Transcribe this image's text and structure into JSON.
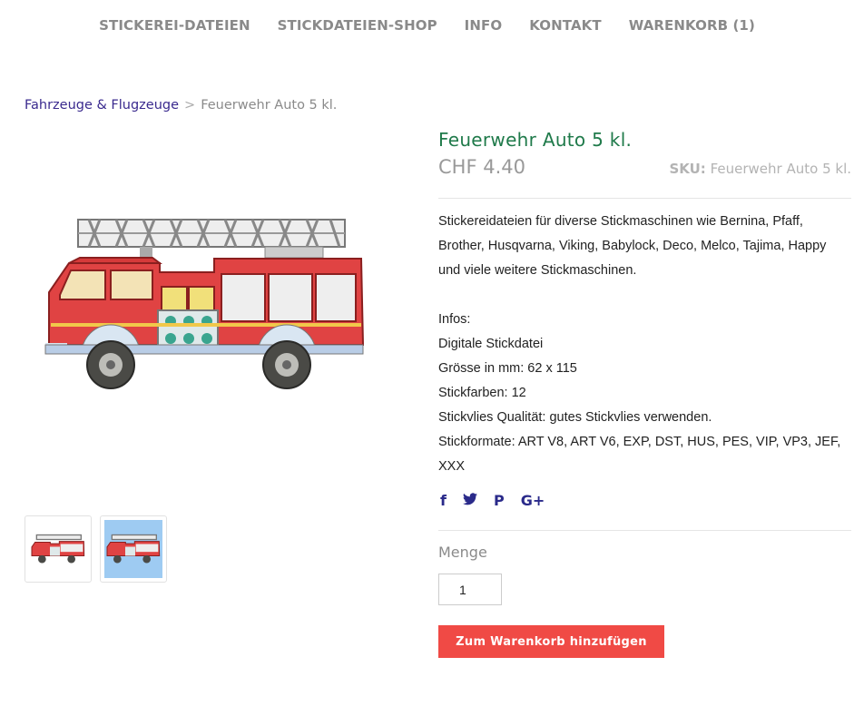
{
  "nav": {
    "items": [
      {
        "label": "STICKEREI-DATEIEN"
      },
      {
        "label": "STICKDATEIEN-SHOP"
      },
      {
        "label": "INFO"
      },
      {
        "label": "KONTAKT"
      },
      {
        "label": "WARENKORB (1)"
      }
    ]
  },
  "breadcrumb": {
    "category": "Fahrzeuge & Flugzeuge",
    "separator": ">",
    "current": "Feuerwehr Auto 5 kl."
  },
  "product": {
    "title": "Feuerwehr Auto 5 kl.",
    "price": "CHF 4.40",
    "sku_label": "SKU:",
    "sku_value": "Feuerwehr Auto 5 kl.",
    "description": [
      "Stickereidateien für diverse Stickmaschinen wie Bernina, Pfaff,",
      "Brother, Husqvarna, Viking, Babylock, Deco, Melco, Tajima, Happy",
      "und viele weitere Stickmaschinen."
    ],
    "infos": [
      "Infos:",
      "Digitale Stickdatei",
      "Grösse in mm: 62 x 115",
      "Stickfarben: 12",
      "Stickvlies Qualität: gutes Stickvlies verwenden.",
      "Stickformate: ART V8, ART V6, EXP, DST, HUS, PES, VIP, VP3, JEF,",
      "XXX"
    ]
  },
  "social": {
    "facebook": "f",
    "twitter": "🐦",
    "pinterest": "P",
    "googleplus": "G+"
  },
  "quantity": {
    "label": "Menge",
    "value": "1"
  },
  "cart_button": {
    "label": "Zum Warenkorb hinzufügen"
  },
  "colors": {
    "title": "#1f7a4a",
    "accent_button": "#f04a45",
    "link": "#3a2a8e",
    "thumb_bg": "#9ecbf2"
  }
}
